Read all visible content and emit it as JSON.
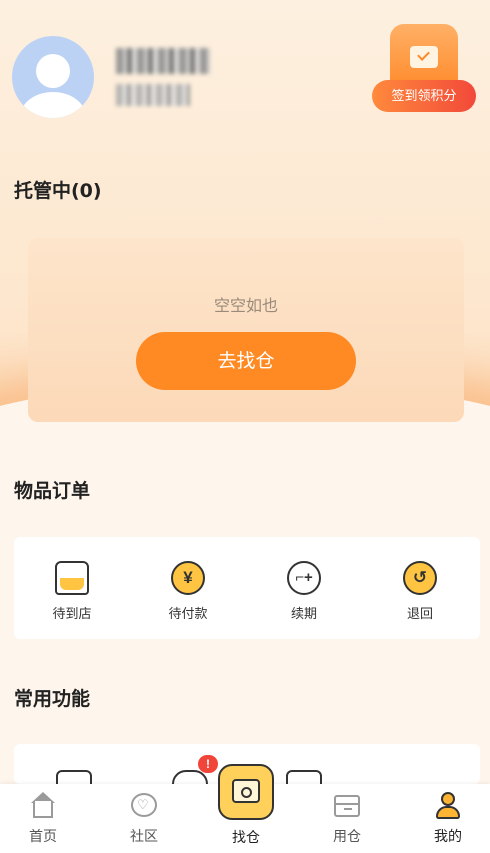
{
  "header": {
    "signin_label": "签到领积分"
  },
  "custody": {
    "title": "托管中(0)",
    "empty_text": "空空如也",
    "find_button": "去找仓"
  },
  "orders": {
    "title": "物品订单",
    "items": [
      {
        "label": "待到店",
        "icon": "store-icon"
      },
      {
        "label": "待付款",
        "icon": "yen-icon"
      },
      {
        "label": "续期",
        "icon": "renew-icon"
      },
      {
        "label": "退回",
        "icon": "return-icon"
      }
    ]
  },
  "functions": {
    "title": "常用功能",
    "badge": "!"
  },
  "tabbar": {
    "tabs": [
      {
        "label": "首页",
        "icon": "home-icon"
      },
      {
        "label": "社区",
        "icon": "community-icon"
      },
      {
        "label": "找仓",
        "icon": "find-warehouse-icon"
      },
      {
        "label": "用仓",
        "icon": "use-warehouse-icon"
      },
      {
        "label": "我的",
        "icon": "profile-icon"
      }
    ]
  },
  "colors": {
    "accent": "#ff8a24",
    "highlight": "#ffd27a",
    "badge": "#f2453a"
  }
}
